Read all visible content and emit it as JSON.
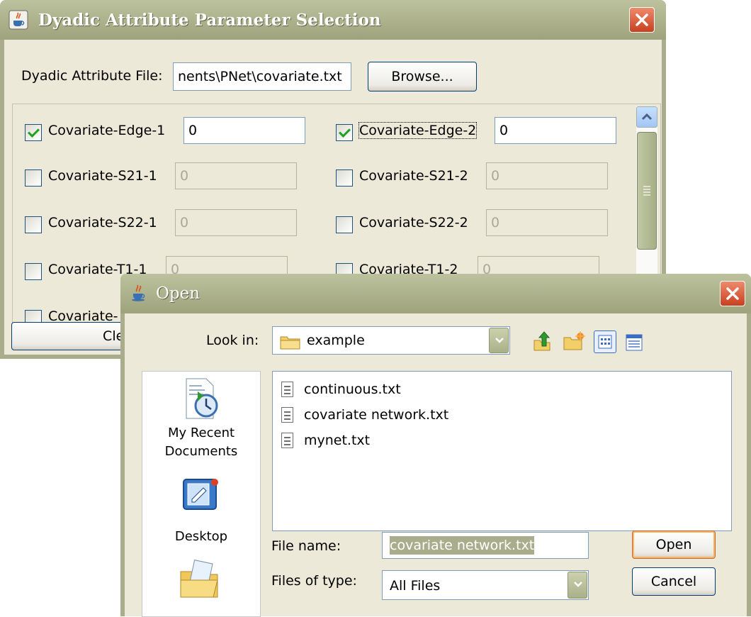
{
  "dyadic_dialog": {
    "title": "Dyadic Attribute Parameter Selection",
    "file_label": "Dyadic Attribute File:",
    "file_value": "nents\\PNet\\covariate.txt",
    "browse_label": "Browse...",
    "clear_label": "Clea",
    "params": [
      {
        "label": "Covariate-Edge-1",
        "value": "0",
        "checked": true
      },
      {
        "label": "Covariate-Edge-2",
        "value": "0",
        "checked": true
      },
      {
        "label": "Covariate-S21-1",
        "value": "0",
        "checked": false
      },
      {
        "label": "Covariate-S21-2",
        "value": "0",
        "checked": false
      },
      {
        "label": "Covariate-S22-1",
        "value": "0",
        "checked": false
      },
      {
        "label": "Covariate-S22-2",
        "value": "0",
        "checked": false
      },
      {
        "label": "Covariate-T1-1",
        "value": "0",
        "checked": false
      },
      {
        "label": "Covariate-T1-2",
        "value": "0",
        "checked": false
      },
      {
        "label": "Covariate-",
        "checked": false
      }
    ]
  },
  "open_dialog": {
    "title": "Open",
    "look_in_label": "Look in:",
    "look_in_value": "example",
    "places": [
      {
        "label_line1": "My Recent",
        "label_line2": "Documents",
        "icon": "recent-documents-icon"
      },
      {
        "label_line1": "Desktop",
        "icon": "desktop-icon"
      },
      {
        "label_line1": "",
        "icon": "my-documents-folder-icon"
      }
    ],
    "files": [
      {
        "name": "continuous.txt"
      },
      {
        "name": "covariate network.txt"
      },
      {
        "name": "mynet.txt"
      }
    ],
    "file_name_label": "File name:",
    "file_name_value": "covariate network.txt",
    "files_of_type_label": "Files of type:",
    "files_of_type_value": "All Files",
    "open_button": "Open",
    "cancel_button": "Cancel",
    "toolbar_icons": [
      "up-one-level-icon",
      "new-folder-icon",
      "list-view-icon",
      "details-view-icon"
    ]
  },
  "colors": {
    "title_bar": "#a9ad8b",
    "dialog_body": "#ece9d8",
    "close_button": "#d6532f",
    "selection_highlight": "#a9ad8b"
  }
}
